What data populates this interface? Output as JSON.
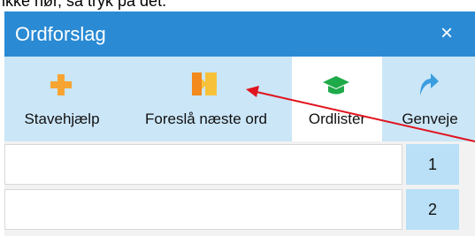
{
  "instruction_text": "ikke hør, så tryk på det.",
  "window": {
    "title": "Ordforslag",
    "close_glyph": "×"
  },
  "toolbar": {
    "items": [
      {
        "label": "Stavehjælp",
        "icon": "plus-icon",
        "color": "#f7a532"
      },
      {
        "label": "Foreslå næste ord",
        "icon": "next-word-icon",
        "color": "#f7a532"
      },
      {
        "label": "Ordlister",
        "icon": "graduation-cap-icon",
        "color": "#1faa4a"
      },
      {
        "label": "Genveje",
        "icon": "shortcut-arrow-icon",
        "color": "#3a9de0"
      }
    ],
    "selected_index": 2
  },
  "suggestions": [
    {
      "text": "",
      "number": "1"
    },
    {
      "text": "",
      "number": "2"
    }
  ],
  "colors": {
    "titlebar": "#2a8ad4",
    "toolbar": "#cbe6f7",
    "number_cell": "#b9e0f6",
    "annotation_arrow": "#e0141e"
  }
}
